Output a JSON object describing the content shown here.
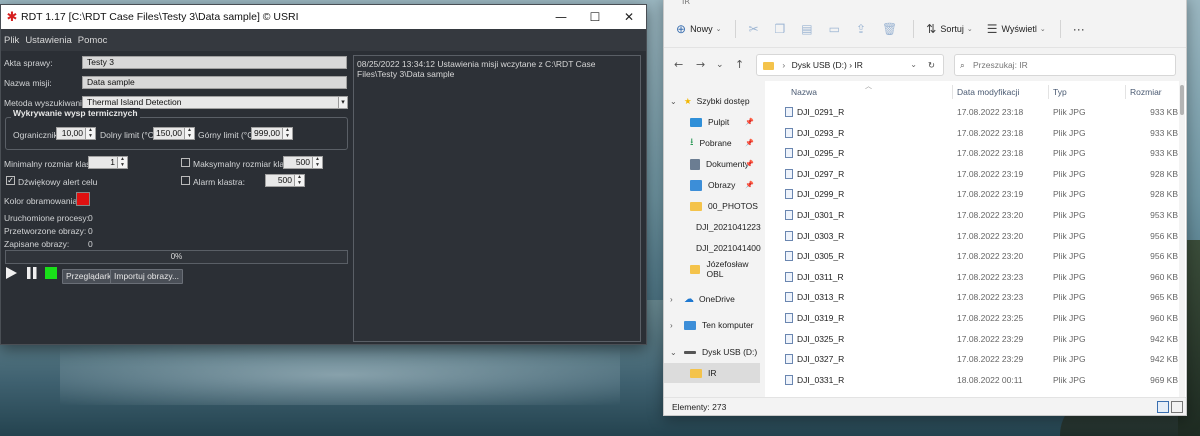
{
  "rdt": {
    "title": "RDT 1.17 [C:\\RDT Case Files\\Testy 3\\Data sample] © USRI",
    "menu": [
      "Plik",
      "Ustawienia",
      "Pomoc"
    ],
    "akta_label": "Akta sprawy:",
    "akta_value": "Testy 3",
    "misja_label": "Nazwa misji:",
    "misja_value": "Data sample",
    "metoda_label": "Metoda wyszukiwania:",
    "metoda_value": "Thermal Island Detection",
    "group_title": "Wykrywanie wysp termicznych",
    "ogranicznik_label": "Ogranicznik:",
    "ogranicznik_value": "10,00",
    "dolny_label": "Dolny limit (°C)",
    "dolny_value": "150,00",
    "gorny_label": "Górny limit (°C)",
    "gorny_value": "999,00",
    "min_label": "Minimalny rozmiar klastra:",
    "min_value": "1",
    "max_label": "Maksymalny rozmiar klastra:",
    "max_value": "500",
    "alert_label": "Dźwiękowy alert celu",
    "alarm_label": "Alarm klastra:",
    "alarm_value": "500",
    "kolor_label": "Kolor obramowania:",
    "border_color": "#e01010",
    "procesy_label": "Uruchomione procesy:",
    "procesy_value": "0",
    "przetworzone_label": "Przetworzone obrazy:",
    "przetworzone_value": "0",
    "zapisane_label": "Zapisane obrazy:",
    "zapisane_value": "0",
    "progress_text": "0%",
    "progress_value": 0,
    "btn_przegladarka": "Przeglądarka",
    "btn_importuj": "Importuj obrazy...",
    "log_text": "08/25/2022 13:34:12 Ustawienia misji wczytane z  C:\\RDT Case Files\\Testy 3\\Data sample"
  },
  "explorer": {
    "title": "IR",
    "toolbar": {
      "nowy": "Nowy",
      "sortuj": "Sortuj",
      "wyswietl": "Wyświetl"
    },
    "address": "Dysk USB (D:)  ›  IR",
    "address_prefix": "›",
    "search_placeholder": "Przeszukaj: IR",
    "nav": [
      {
        "label": "Szybki dostęp",
        "icon": "star-icon",
        "color": "#f2b600"
      },
      {
        "label": "Pulpit",
        "icon": "desktop-icon",
        "color": "#2f8fd8",
        "pin": true
      },
      {
        "label": "Pobrane",
        "icon": "download-icon",
        "color": "#2f9a5a",
        "pin": true
      },
      {
        "label": "Dokumenty",
        "icon": "documents-icon",
        "color": "#6b7d92",
        "pin": true
      },
      {
        "label": "Obrazy",
        "icon": "pictures-icon",
        "color": "#3c8ed8",
        "pin": true
      },
      {
        "label": "00_PHOTOS",
        "icon": "folder-icon",
        "color": "#f4c34b"
      },
      {
        "label": "DJI_2021041223",
        "icon": "folder-icon",
        "color": "#f4c34b"
      },
      {
        "label": "DJI_2021041400",
        "icon": "folder-icon",
        "color": "#f4c34b"
      },
      {
        "label": "Józefosław OBL",
        "icon": "folder-icon",
        "color": "#f4c34b"
      },
      {
        "label": "OneDrive",
        "icon": "cloud-icon",
        "color": "#1e78d0"
      },
      {
        "label": "Ten komputer",
        "icon": "computer-icon",
        "color": "#3c8ed8"
      },
      {
        "label": "Dysk USB (D:)",
        "icon": "drive-icon",
        "color": "#555555"
      },
      {
        "label": "IR",
        "icon": "folder-icon",
        "color": "#f4c34b"
      }
    ],
    "columns": {
      "name": "Nazwa",
      "date": "Data modyfikacji",
      "type": "Typ",
      "size": "Rozmiar"
    },
    "files": [
      {
        "name": "DJI_0291_R",
        "date": "17.08.2022 23:18",
        "type": "Plik JPG",
        "size": "933 KB"
      },
      {
        "name": "DJI_0293_R",
        "date": "17.08.2022 23:18",
        "type": "Plik JPG",
        "size": "933 KB"
      },
      {
        "name": "DJI_0295_R",
        "date": "17.08.2022 23:18",
        "type": "Plik JPG",
        "size": "933 KB"
      },
      {
        "name": "DJI_0297_R",
        "date": "17.08.2022 23:19",
        "type": "Plik JPG",
        "size": "928 KB"
      },
      {
        "name": "DJI_0299_R",
        "date": "17.08.2022 23:19",
        "type": "Plik JPG",
        "size": "928 KB"
      },
      {
        "name": "DJI_0301_R",
        "date": "17.08.2022 23:20",
        "type": "Plik JPG",
        "size": "953 KB"
      },
      {
        "name": "DJI_0303_R",
        "date": "17.08.2022 23:20",
        "type": "Plik JPG",
        "size": "956 KB"
      },
      {
        "name": "DJI_0305_R",
        "date": "17.08.2022 23:20",
        "type": "Plik JPG",
        "size": "956 KB"
      },
      {
        "name": "DJI_0311_R",
        "date": "17.08.2022 23:23",
        "type": "Plik JPG",
        "size": "960 KB"
      },
      {
        "name": "DJI_0313_R",
        "date": "17.08.2022 23:23",
        "type": "Plik JPG",
        "size": "965 KB"
      },
      {
        "name": "DJI_0319_R",
        "date": "17.08.2022 23:25",
        "type": "Plik JPG",
        "size": "960 KB"
      },
      {
        "name": "DJI_0325_R",
        "date": "17.08.2022 23:29",
        "type": "Plik JPG",
        "size": "942 KB"
      },
      {
        "name": "DJI_0327_R",
        "date": "17.08.2022 23:29",
        "type": "Plik JPG",
        "size": "942 KB"
      },
      {
        "name": "DJI_0331_R",
        "date": "18.08.2022 00:11",
        "type": "Plik JPG",
        "size": "969 KB"
      }
    ],
    "status": "Elementy: 273"
  }
}
